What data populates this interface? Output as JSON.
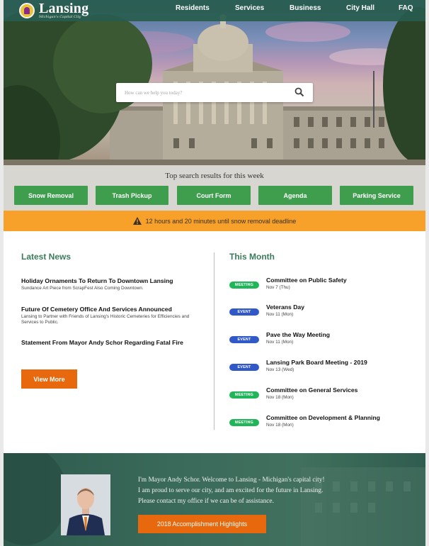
{
  "header": {
    "logo_name": "Lansing",
    "logo_tagline": "Michigan's Capital City",
    "nav": [
      "Residents",
      "Services",
      "Business",
      "City Hall",
      "FAQ"
    ]
  },
  "search": {
    "placeholder": "How can we help you today?"
  },
  "top_search": {
    "title": "Top search results for this week",
    "buttons": [
      "Snow Removal",
      "Trash Pickup",
      "Court Form",
      "Agenda",
      "Parking Service"
    ]
  },
  "alert": {
    "text": "12 hours and 20 minutes until snow removal deadline"
  },
  "news": {
    "title": "Latest News",
    "items": [
      {
        "title": "Holiday Ornaments To Return To Downtown Lansing",
        "sub": "Sundance Art Piece from ScrapFest Also Coming Downtown."
      },
      {
        "title": "Future Of Cemetery Office And Services Announced",
        "sub": "Lansing to Partner with Friends of Lansing's Historic Cemeteries for Efficiencies and Services to Public."
      },
      {
        "title": "Statement From Mayor Andy Schor Regarding Fatal Fire",
        "sub": ""
      }
    ],
    "view_more": "View More"
  },
  "events": {
    "title": "This Month",
    "items": [
      {
        "badge": "MEETING",
        "type": "meeting",
        "title": "Committee on Public Safety",
        "date": "Nov 7 (Thu)"
      },
      {
        "badge": "EVENT",
        "type": "event",
        "title": "Veterans Day",
        "date": "Nov 11 (Mon)"
      },
      {
        "badge": "EVENT",
        "type": "event",
        "title": "Pave the Way Meeting",
        "date": "Nov 11 (Mon)"
      },
      {
        "badge": "EVENT",
        "type": "event",
        "title": "Lansing Park Board Meeting - 2019",
        "date": "Nov 13 (Wed)"
      },
      {
        "badge": "MEETING",
        "type": "meeting",
        "title": "Committee on General Services",
        "date": "Nov 18 (Mon)"
      },
      {
        "badge": "MEETING",
        "type": "meeting",
        "title": "Committee on Development & Planning",
        "date": "Nov 18 (Mon)"
      }
    ]
  },
  "mayor": {
    "line1": "I'm Mayor Andy Schor. Welcome to Lansing - Michigan's capital city!",
    "line2": "I am proud to serve our city, and am excited for the future in Lansing.",
    "line3": "Please contact my office if we can be of assistance.",
    "button": "2018 Accomplishment Highlights"
  },
  "colors": {
    "nav_bg": "#285c4e",
    "quick_button": "#3f9d4e",
    "alert": "#f7a12b",
    "section_title": "#3b7a5c",
    "cta": "#e8680d",
    "meeting_badge": "#21b559",
    "event_badge": "#3058c6"
  },
  "icons": [
    "logo-seal-icon",
    "search-icon",
    "warning-icon"
  ]
}
